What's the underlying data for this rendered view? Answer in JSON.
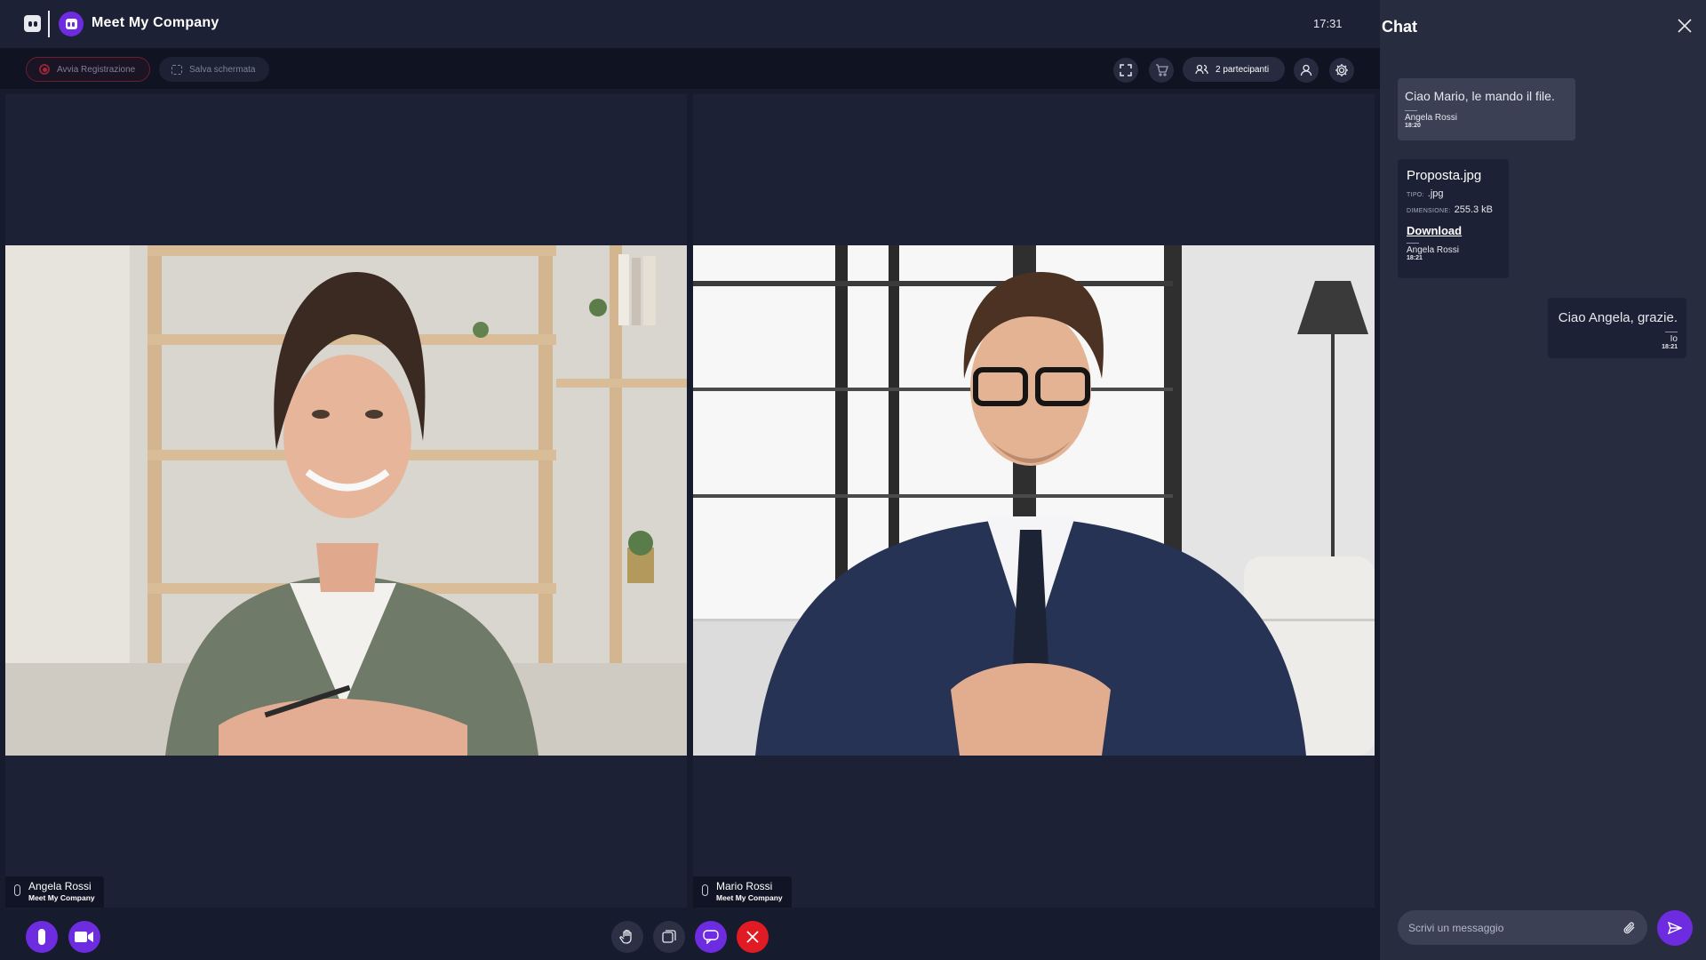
{
  "app": {
    "title": "Meet My Company",
    "clock": "17:31",
    "accent": "#6d2ce0",
    "hangup_color": "#e01b24"
  },
  "toolbar": {
    "record_label": "Avvia Registrazione",
    "screenshot_label": "Salva schermata",
    "participants_label": "2 partecipanti",
    "icons": [
      "fullscreen-icon",
      "cart-icon",
      "users-icon",
      "user-icon",
      "gear-icon"
    ]
  },
  "participants": [
    {
      "name": "Angela Rossi",
      "company": "Meet My Company"
    },
    {
      "name": "Mario Rossi",
      "company": "Meet My Company"
    }
  ],
  "controls": {
    "icons": [
      "microphone-icon",
      "camera-icon",
      "raise-hand-icon",
      "layout-icon",
      "chat-icon",
      "hangup-icon"
    ]
  },
  "chat": {
    "title": "Chat",
    "messages": [
      {
        "text": "Ciao Mario, le mando il file.",
        "author": "Angela Rossi",
        "time": "18:20"
      },
      {
        "file_name": "Proposta.jpg",
        "type_label": "TIPO:",
        "type_value": ".jpg",
        "size_label": "DIMENSIONE:",
        "size_value": "255.3 kB",
        "download_label": "Download",
        "author": "Angela Rossi",
        "time": "18:21"
      },
      {
        "text": "Ciao Angela, grazie.",
        "author": "Io",
        "time": "18:21"
      }
    ],
    "input_placeholder": "Scrivi un messaggio"
  }
}
